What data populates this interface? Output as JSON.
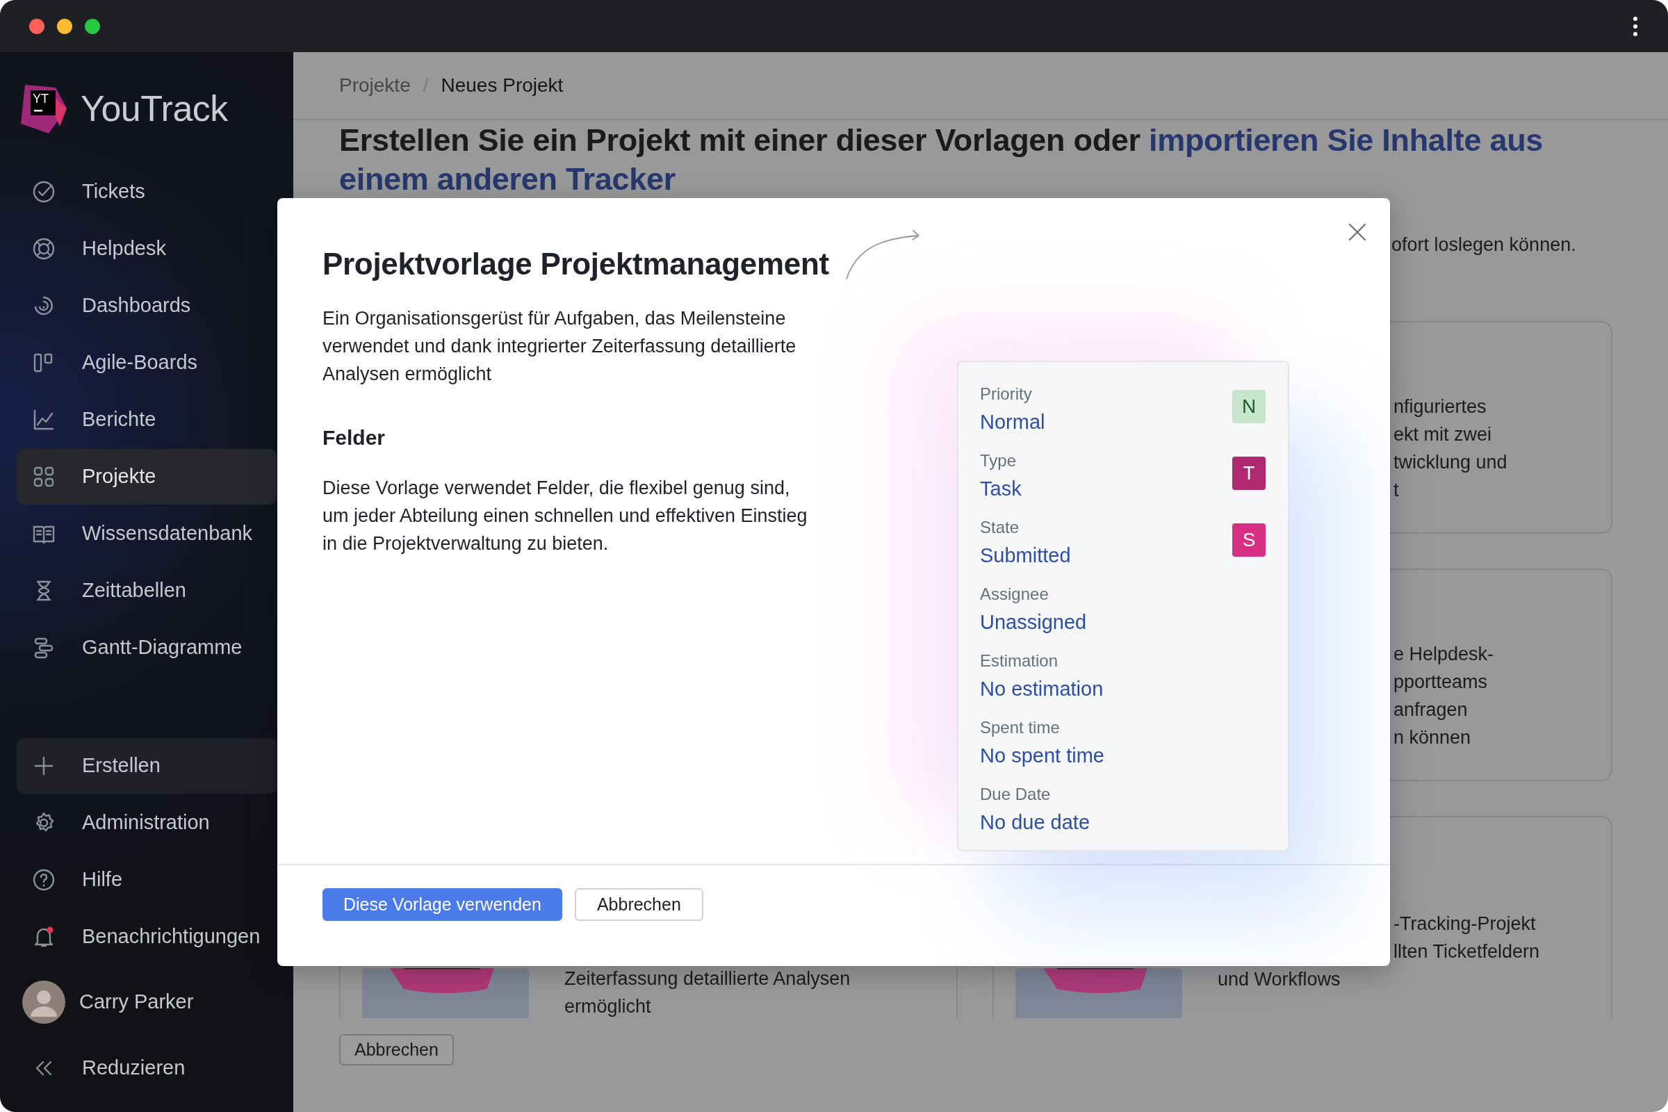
{
  "sidebar": {
    "logo": {
      "mark": "YT",
      "name": "YouTrack"
    },
    "items": [
      {
        "kind": "tickets",
        "label": "Tickets",
        "selected": false
      },
      {
        "kind": "helpdesk",
        "label": "Helpdesk",
        "selected": false
      },
      {
        "kind": "dashboards",
        "label": "Dashboards",
        "selected": false
      },
      {
        "kind": "boards",
        "label": "Agile-Boards",
        "selected": false
      },
      {
        "kind": "reports",
        "label": "Berichte",
        "selected": false
      },
      {
        "kind": "projects",
        "label": "Projekte",
        "selected": true
      },
      {
        "kind": "knowledge",
        "label": "Wissensdatenbank",
        "selected": false
      },
      {
        "kind": "timesheets",
        "label": "Zeittabellen",
        "selected": false
      },
      {
        "kind": "gantt",
        "label": "Gantt-Diagramme",
        "selected": false
      }
    ],
    "actions": [
      {
        "kind": "create",
        "label": "Erstellen"
      },
      {
        "kind": "settings",
        "label": "Administration"
      },
      {
        "kind": "help",
        "label": "Hilfe"
      },
      {
        "kind": "notifications",
        "label": "Benachrichtigungen",
        "unread": true
      }
    ],
    "user": {
      "name": "Carry Parker"
    },
    "collapse": {
      "label": "Reduzieren"
    }
  },
  "breadcrumb_separator": "/",
  "breadcrumb": [
    {
      "label": "Projekte",
      "current": false
    },
    {
      "label": "Neues Projekt",
      "current": true
    }
  ],
  "heading": {
    "text": "Erstellen Sie ein Projekt mit einer dieser Vorlagen oder",
    "link_lines": [
      "importieren Sie Inhalte aus",
      "einem anderen Tracker"
    ]
  },
  "subtitle_fragment": "ofort loslegen können.",
  "cards": [
    {
      "kind": "text",
      "lines": [
        {
          "kind": "beside_dialog",
          "text": "nfiguriertes"
        },
        {
          "kind": "beside_dialog",
          "text": "ekt mit zwei"
        },
        {
          "kind": "beside_dialog",
          "text": "twicklung und"
        },
        {
          "kind": "beside_dialog",
          "text": "t"
        }
      ]
    },
    {
      "kind": "text",
      "lines": [
        {
          "kind": "beside_dialog",
          "text": "e Helpdesk-"
        },
        {
          "kind": "beside_dialog",
          "text": "pportteams"
        },
        {
          "kind": "beside_dialog",
          "text": "anfragen"
        },
        {
          "kind": "beside_dialog",
          "text": "n können"
        }
      ]
    },
    {
      "kind": "with_image",
      "lines": [
        {
          "kind": "full",
          "text": "Zeiterfassung detaillierte Analysen"
        },
        {
          "kind": "full",
          "text": "ermöglicht"
        }
      ]
    },
    {
      "kind": "with_image",
      "lines": [
        {
          "kind": "beside_dialog",
          "text": "-Tracking-Projekt"
        },
        {
          "kind": "beside_dialog",
          "text": "llten Ticketfeldern"
        },
        {
          "kind": "full",
          "text": "und Workflows"
        }
      ]
    }
  ],
  "page_cancel": "Abbrechen",
  "dialog": {
    "title": "Projektvorlage Projektmanagement",
    "description": "Ein Organisationsgerüst für Aufgaben, das Meilensteine verwendet und dank integrierter Zeiterfassung detaillierte Analysen ermöglicht",
    "section_title": "Felder",
    "section_text": "Diese Vorlage verwendet Felder, die flexibel genug sind, um jeder Abteilung einen schnellen und effektiven Einstieg in die Projektverwaltung zu bieten.",
    "fields": [
      {
        "label": "Priority",
        "value": "Normal",
        "badge": "N",
        "color": "#c6e5cc"
      },
      {
        "label": "Type",
        "value": "Task",
        "badge": "T",
        "color": "#b0286d"
      },
      {
        "label": "State",
        "value": "Submitted",
        "badge": "S",
        "color": "#d62f84"
      },
      {
        "label": "Assignee",
        "value": "Unassigned"
      },
      {
        "label": "Estimation",
        "value": "No estimation"
      },
      {
        "label": "Spent time",
        "value": "No spent time"
      },
      {
        "label": "Due Date",
        "value": "No due date"
      }
    ],
    "buttons": [
      {
        "kind": "primary",
        "label": "Diese Vorlage verwenden"
      },
      {
        "kind": "secondary",
        "label": "Abbrechen"
      }
    ]
  }
}
